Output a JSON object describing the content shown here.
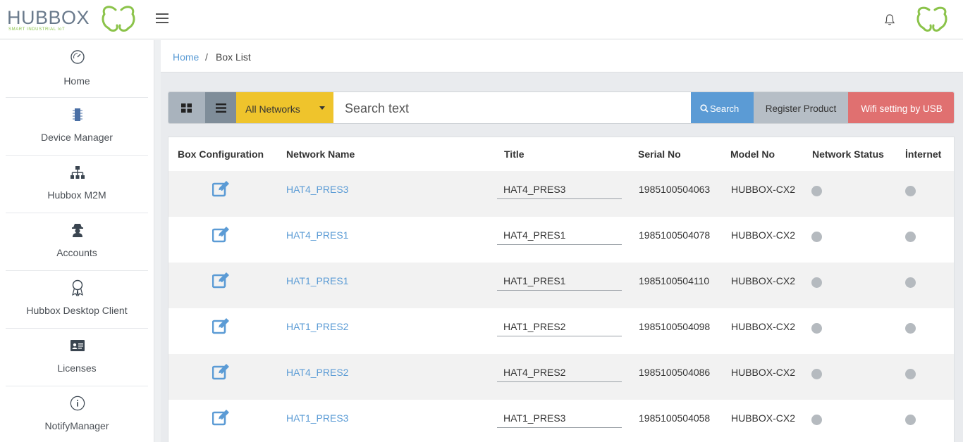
{
  "header": {
    "logo_text": "HUBBOX",
    "logo_tagline": "SMART INDUSTRIAL IoT"
  },
  "sidebar": {
    "items": [
      {
        "label": "Home",
        "icon": "speedometer-icon"
      },
      {
        "label": "Device Manager",
        "icon": "chip-icon"
      },
      {
        "label": "Hubbox M2M",
        "icon": "sitemap-icon"
      },
      {
        "label": "Accounts",
        "icon": "user-secret-icon"
      },
      {
        "label": "Hubbox Desktop Client",
        "icon": "award-icon"
      },
      {
        "label": "Licenses",
        "icon": "id-card-icon"
      },
      {
        "label": "NotifyManager",
        "icon": "info-circle-icon"
      }
    ]
  },
  "breadcrumb": {
    "home": "Home",
    "separator": "/",
    "current": "Box List"
  },
  "toolbar": {
    "network_select": "All Networks",
    "search_placeholder": "Search text",
    "search_label": "Search",
    "register_label": "Register Product",
    "wifi_label": "Wifi setting by USB"
  },
  "table": {
    "headers": {
      "config": "Box Configuration",
      "network": "Network Name",
      "title": "Title",
      "serial": "Serial No",
      "model": "Model No",
      "status": "Network Status",
      "internet": "İnternet"
    },
    "rows": [
      {
        "network": "HAT4_PRES3",
        "title": "HAT4_PRES3",
        "serial": "1985100504063",
        "model": "HUBBOX-CX2"
      },
      {
        "network": "HAT4_PRES1",
        "title": "HAT4_PRES1",
        "serial": "1985100504078",
        "model": "HUBBOX-CX2"
      },
      {
        "network": "HAT1_PRES1",
        "title": "HAT1_PRES1",
        "serial": "1985100504110",
        "model": "HUBBOX-CX2"
      },
      {
        "network": "HAT1_PRES2",
        "title": "HAT1_PRES2",
        "serial": "1985100504098",
        "model": "HUBBOX-CX2"
      },
      {
        "network": "HAT4_PRES2",
        "title": "HAT4_PRES2",
        "serial": "1985100504086",
        "model": "HUBBOX-CX2"
      },
      {
        "network": "HAT1_PRES3",
        "title": "HAT1_PRES3",
        "serial": "1985100504058",
        "model": "HUBBOX-CX2"
      }
    ]
  },
  "colors": {
    "accent_blue": "#5b9bd5",
    "network_yellow": "#efc42c",
    "wifi_red": "#e07070",
    "logo_green": "#8bc34a",
    "status_gray": "#b5babf"
  }
}
